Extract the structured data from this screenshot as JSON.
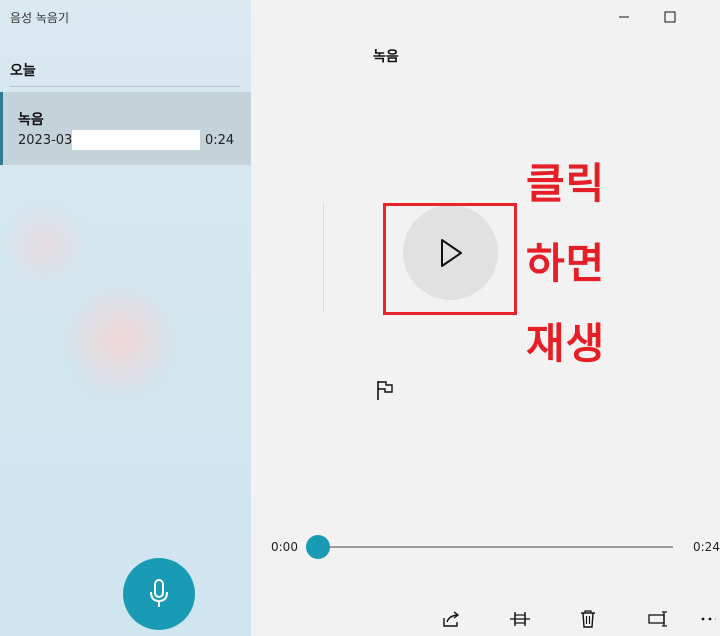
{
  "app": {
    "title": "음성 녹음기"
  },
  "sidebar": {
    "section": "오늘",
    "items": [
      {
        "name": "녹음",
        "date": "2023-03",
        "duration": "0:24"
      }
    ]
  },
  "player": {
    "recording_title": "녹음",
    "current_time": "0:00",
    "total_time": "0:24",
    "progress": 0
  },
  "annotation": {
    "line1": "클릭",
    "line2": "하면",
    "line3": "재생",
    "color": "#e61e26"
  },
  "icons": {
    "minimize": "minimize-icon",
    "maximize": "maximize-icon",
    "play": "play-icon",
    "flag": "flag-icon",
    "microphone": "microphone-icon",
    "share": "share-icon",
    "trim": "trim-icon",
    "delete": "delete-icon",
    "rename": "rename-icon",
    "more": "more-icon"
  },
  "colors": {
    "accent": "#1a9bb5",
    "selected_item": "#c4d2da",
    "highlight_box": "#e8242b"
  }
}
